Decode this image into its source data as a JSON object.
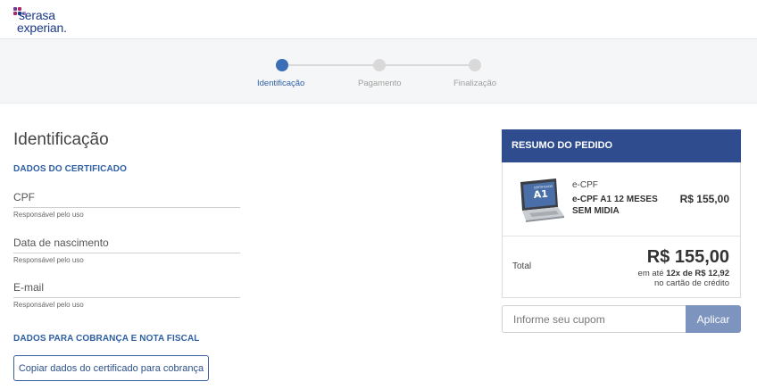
{
  "brand": {
    "line1": "serasa",
    "line2": "experian.",
    "colors": {
      "navy": "#1d3a8a",
      "magenta": "#b0246b",
      "purple": "#6a3d98",
      "blue": "#3a6fb6"
    }
  },
  "stepper": {
    "steps": [
      {
        "label": "Identificação",
        "active": true
      },
      {
        "label": "Pagamento",
        "active": false
      },
      {
        "label": "Finalização",
        "active": false
      }
    ],
    "active_color": "#3a6fb6",
    "inactive_color": "#d9d9d9"
  },
  "form": {
    "title": "Identificação",
    "certificate_section": "DADOS DO CERTIFICADO",
    "fields": [
      {
        "label": "CPF",
        "help": "Responsável pelo uso"
      },
      {
        "label": "Data de nascimento",
        "help": "Responsável pelo uso"
      },
      {
        "label": "E-mail",
        "help": "Responsável pelo uso"
      }
    ],
    "billing_section": "DADOS PARA COBRANÇA E NOTA FISCAL",
    "copy_button": "Copiar dados do certificado para cobrança"
  },
  "summary": {
    "title": "RESUMO DO PEDIDO",
    "product": {
      "image_label": "A1",
      "image_caption": "CERTIFICADO",
      "category": "e-CPF",
      "name": "e-CPF A1 12 MESES SEM MIDIA",
      "price": "R$ 155,00"
    },
    "total_label": "Total",
    "total_value": "R$ 155,00",
    "installment_prefix": "em até",
    "installment_value": "12x de R$ 12,92",
    "installment_suffix": "no cartão de crédito",
    "header_color": "#2e4c8e"
  },
  "coupon": {
    "placeholder": "Informe seu cupom",
    "button": "Aplicar",
    "button_color": "#7d94bf"
  }
}
